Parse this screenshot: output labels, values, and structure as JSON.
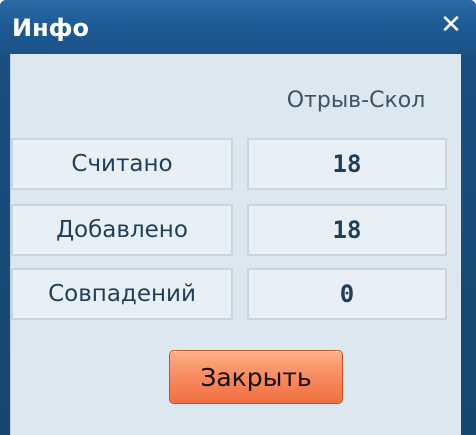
{
  "window": {
    "title": "Инфо",
    "close_icon": "✕"
  },
  "table": {
    "column_header": "Отрыв-Скол",
    "rows": [
      {
        "label": "Считано",
        "value": "18"
      },
      {
        "label": "Добавлено",
        "value": "18"
      },
      {
        "label": "Совпадений",
        "value": "0"
      }
    ]
  },
  "footer": {
    "close_label": "Закрыть"
  },
  "colors": {
    "titlebar": "#1d5a94",
    "client_bg": "#dce7ef",
    "button": "#f98a5f"
  }
}
